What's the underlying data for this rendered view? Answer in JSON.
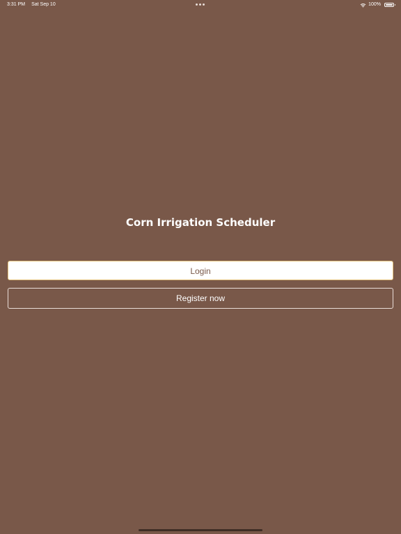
{
  "status_bar": {
    "time": "3:31 PM",
    "date": "Sat Sep 10",
    "battery": "100%"
  },
  "app": {
    "title": "Corn Irrigation Scheduler"
  },
  "buttons": {
    "login_label": "Login",
    "register_label": "Register now"
  },
  "colors": {
    "background": "#795849",
    "button_text": "#795849",
    "login_border": "#e2c07a",
    "white": "#ffffff"
  },
  "icons": {
    "multitask": "more-dots-icon",
    "wifi": "wifi-icon",
    "battery": "battery-icon"
  }
}
